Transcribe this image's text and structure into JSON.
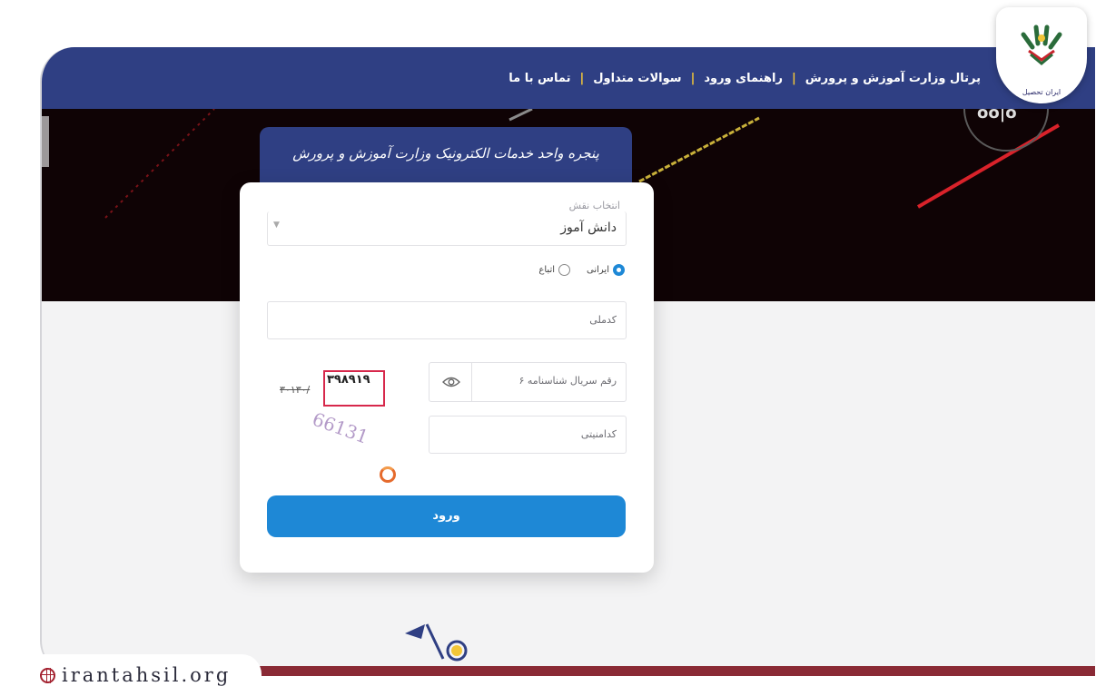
{
  "nav": {
    "items": [
      "پرتال وزارت آموزش و پرورش",
      "راهنمای ورود",
      "سوالات متداول",
      "تماس با ما"
    ],
    "separator": "|"
  },
  "logo": {
    "text": "ایران تحصیل"
  },
  "hero": {
    "corner_text": "oo|o"
  },
  "title_tab": {
    "text": "پنجره واحد خدمات الکترونیک وزارت آموزش و پرورش"
  },
  "login": {
    "role_legend": "انتخاب نقش",
    "role_value": "دانش آموز",
    "nationality": {
      "options": [
        "ایرانی",
        "اتباع"
      ],
      "selected": "ایرانی"
    },
    "national_code_placeholder": "کدملی",
    "serial_placeholder": "۶ رقم سریال شناسنامه",
    "captcha_placeholder": "کدامنیتی",
    "captcha_value": "۳۹۸۹۱۹",
    "captcha_struck": "۳۰۱۳۰/",
    "captcha_image_text": "66131",
    "submit_label": "ورود"
  },
  "watermark": {
    "text": "irantahsil.org"
  },
  "colors": {
    "nav_bg": "#2f3f83",
    "nav_separator": "#f3c638",
    "hero_bg": "#0f0305",
    "accent_blue": "#1e88d6",
    "captcha_highlight": "#d7284b",
    "bottom_strip": "#8a2a35"
  },
  "icons": {
    "eye": "eye-icon",
    "refresh": "refresh-icon",
    "globe": "globe-icon",
    "caret": "chevron-down-icon"
  }
}
